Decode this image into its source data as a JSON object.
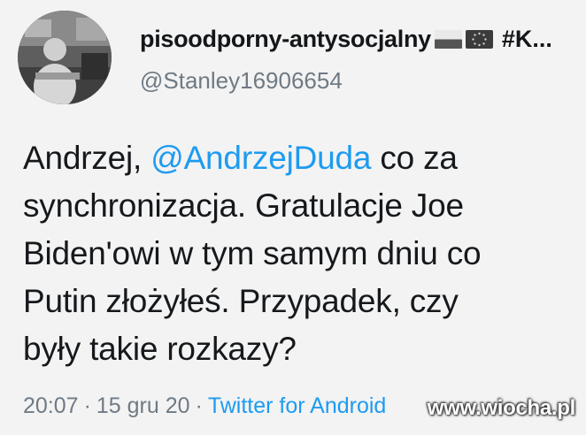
{
  "author": {
    "display_name": "pisoodporny-antysocjalny",
    "flags": [
      "flag-pl-icon",
      "flag-eu-icon"
    ],
    "tag_truncated": "#K...",
    "handle": "@Stanley16906654"
  },
  "tweet": {
    "lines": [
      {
        "before": "Andrzej, ",
        "mention": "@AndrzejDuda",
        "after": " co za"
      },
      {
        "text": "synchronizacja. Gratulacje Joe"
      },
      {
        "text": "Biden'owi w tym samym dniu co"
      },
      {
        "text": "Putin złożyłeś. Przypadek, czy"
      },
      {
        "text": "były takie rozkazy?"
      }
    ]
  },
  "meta": {
    "time": "20:07",
    "date": "15 gru 20",
    "separator": "·",
    "source": "Twitter for Android"
  },
  "watermark": "www.wiocha.pl",
  "colors": {
    "background": "#f3f3f3",
    "text": "#16191c",
    "secondary": "#6f7a84",
    "link": "#1d9bf0"
  }
}
